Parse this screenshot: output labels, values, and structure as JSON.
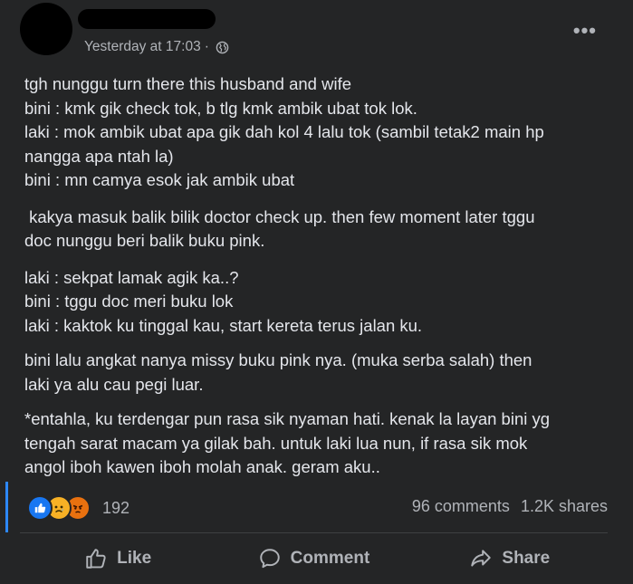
{
  "post": {
    "timestamp": "Yesterday at 17:03",
    "separator": "·",
    "more_label": "•••",
    "paragraphs": [
      [
        "tgh nunggu turn there this husband and wife",
        "bini : kmk gik check tok, b tlg kmk ambik ubat tok lok.",
        "laki : mok ambik ubat apa gik dah kol 4 lalu tok (sambil tetak2 main hp",
        "nangga apa ntah la)",
        "bini : mn camya esok jak ambik ubat"
      ],
      [
        " kakya masuk balik bilik doctor check up. then few moment later tggu",
        "doc nunggu beri balik buku pink."
      ],
      [
        "laki : sekpat lamak agik ka..?",
        "bini : tggu doc meri buku lok",
        "laki : kaktok ku tinggal kau, start kereta terus jalan ku."
      ],
      [
        "bini lalu angkat nanya missy buku pink nya. (muka serba salah) then",
        "laki ya alu cau pegi luar."
      ],
      [
        "*entahla, ku terdengar pun rasa sik nyaman hati. kenak la layan bini yg",
        "tengah sarat macam ya gilak bah. untuk laki lua nun, if rasa sik mok",
        "angol iboh kawen iboh molah anak. geram aku.."
      ]
    ]
  },
  "engagement": {
    "reactions": [
      "like-icon",
      "sad-icon",
      "angry-icon"
    ],
    "reaction_count": "192",
    "comments": "96 comments",
    "shares": "1.2K shares"
  },
  "actions": {
    "like": "Like",
    "comment": "Comment",
    "share": "Share"
  },
  "colors": {
    "background": "#242526",
    "text": "#e4e6eb",
    "muted": "#b0b3b8",
    "accent": "#2d88ff"
  }
}
